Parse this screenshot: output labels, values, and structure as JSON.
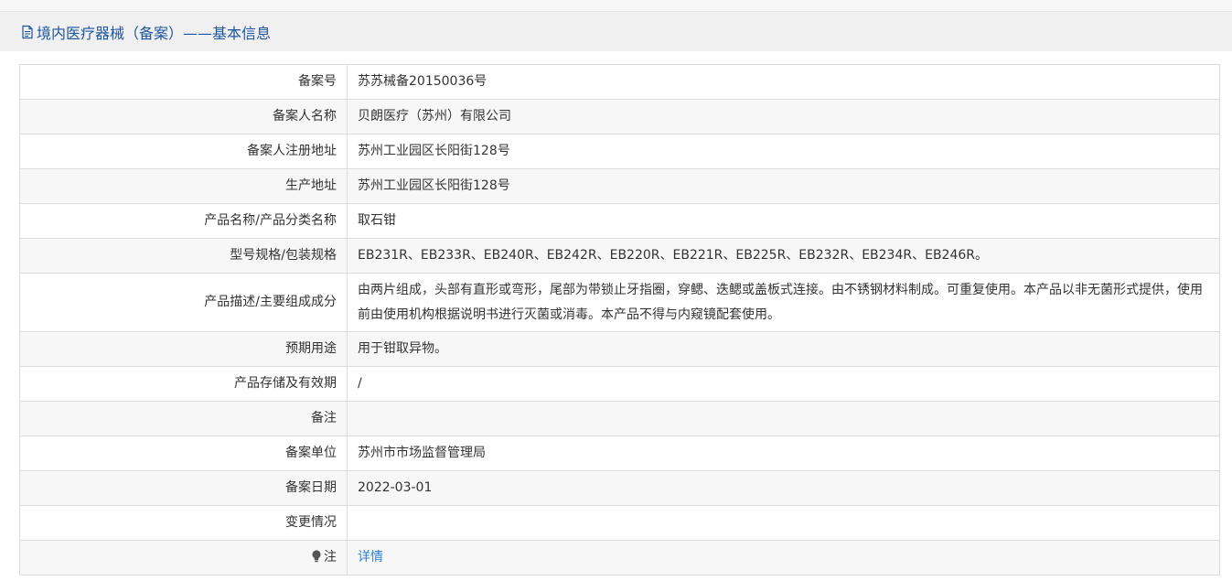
{
  "header": {
    "icon": "document-icon",
    "title": "境内医疗器械（备案）——基本信息"
  },
  "rows": [
    {
      "label": "备案号",
      "value": "苏苏械备20150036号"
    },
    {
      "label": "备案人名称",
      "value": "贝朗医疗（苏州）有限公司"
    },
    {
      "label": "备案人注册地址",
      "value": "苏州工业园区长阳街128号"
    },
    {
      "label": "生产地址",
      "value": "苏州工业园区长阳街128号"
    },
    {
      "label": "产品名称/产品分类名称",
      "value": "取石钳"
    },
    {
      "label": "型号规格/包装规格",
      "value": "EB231R、EB233R、EB240R、EB242R、EB220R、EB221R、EB225R、EB232R、EB234R、EB246R。"
    },
    {
      "label": "产品描述/主要组成成分",
      "value": "由两片组成，头部有直形或弯形，尾部为带锁止牙指圈，穿鳃、迭鳃或盖板式连接。由不锈钢材料制成。可重复使用。本产品以非无菌形式提供，使用前由使用机构根据说明书进行灭菌或消毒。本产品不得与内窥镜配套使用。"
    },
    {
      "label": "预期用途",
      "value": "用于钳取异物。"
    },
    {
      "label": "产品存储及有效期",
      "value": "/"
    },
    {
      "label": "备注",
      "value": ""
    },
    {
      "label": "备案单位",
      "value": "苏州市市场监督管理局"
    },
    {
      "label": "备案日期",
      "value": "2022-03-01"
    },
    {
      "label": "变更情况",
      "value": ""
    }
  ],
  "note": {
    "icon": "lightbulb-icon",
    "label": "注",
    "link_text": "详情"
  }
}
